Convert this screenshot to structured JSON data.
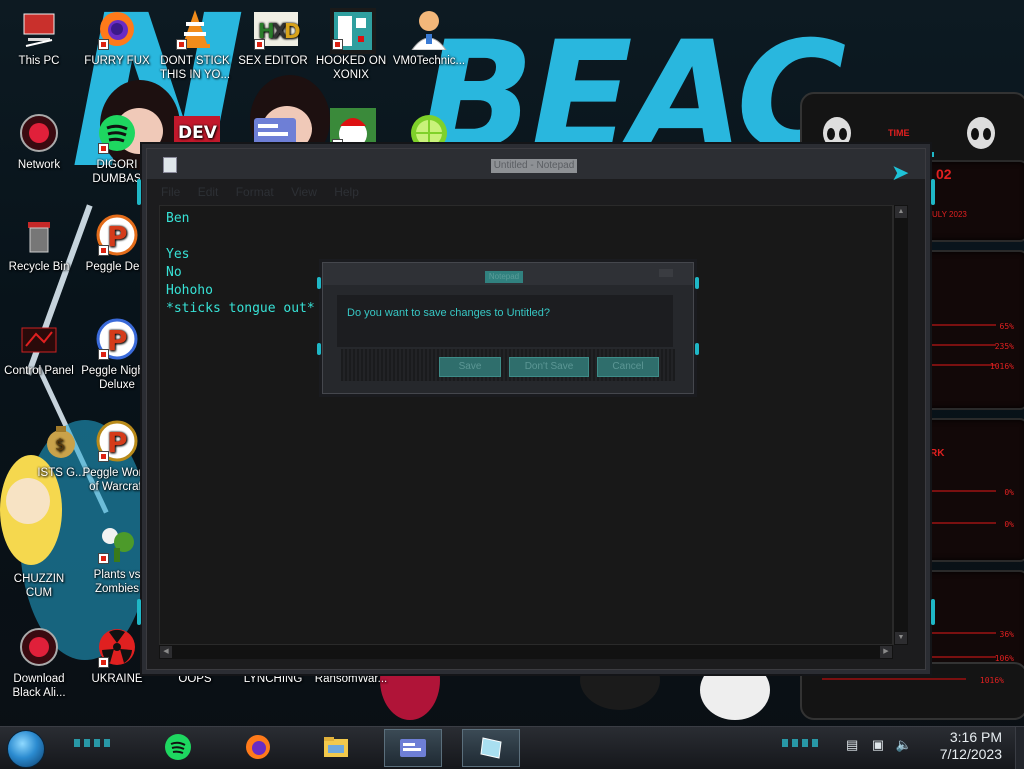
{
  "desktop": {
    "icons": [
      {
        "id": "this-pc",
        "label": "This PC"
      },
      {
        "id": "furry-fux",
        "label": "FURRY FUX"
      },
      {
        "id": "dont-stick",
        "label": "DONT STICK THIS IN YO..."
      },
      {
        "id": "sex-editor",
        "label": "SEX EDITOR"
      },
      {
        "id": "hooked-on-xonix",
        "label": "HOOKED ON XONIX"
      },
      {
        "id": "vm0technic",
        "label": "VM0Technic..."
      },
      {
        "id": "network",
        "label": "Network"
      },
      {
        "id": "digori-dumbas",
        "label": "DIGORI DUMBAS"
      },
      {
        "id": "recycle-bin",
        "label": "Recycle Bin"
      },
      {
        "id": "peggle-deluxe",
        "label": "Peggle Delu"
      },
      {
        "id": "control-panel",
        "label": "Control Panel"
      },
      {
        "id": "peggle-nights",
        "label": "Peggle Nights Deluxe"
      },
      {
        "id": "ists",
        "label": "ISTS G..."
      },
      {
        "id": "peggle-world-of-warcraft",
        "label": "Peggle World of Warcraft"
      },
      {
        "id": "chuzzin-cum",
        "label": "CHUZZIN CUM"
      },
      {
        "id": "plants-vs-zombies",
        "label": "Plants vs Zombies"
      },
      {
        "id": "download-black",
        "label": "Download Black Ali..."
      },
      {
        "id": "ukraine",
        "label": "UKRAINE"
      },
      {
        "id": "oops",
        "label": "OOPS"
      },
      {
        "id": "lynching",
        "label": "LYNCHING"
      },
      {
        "id": "ransomware",
        "label": "RansomWar..."
      }
    ],
    "dev_label": "DEV"
  },
  "notepad": {
    "title": "Untitled - Notepad",
    "menu": [
      "File",
      "Edit",
      "Format",
      "View",
      "Help"
    ],
    "lines": [
      "Ben",
      "",
      "Yes",
      "No",
      "Hohoho",
      "*sticks tongue out*"
    ]
  },
  "dialog": {
    "title": "Notepad",
    "message": "Do you want to save changes to Untitled?",
    "buttons": {
      "save": "Save",
      "dont_save": "Don't Save",
      "cancel": "Cancel"
    }
  },
  "gadget": {
    "time_label": "TIME",
    "date_fragment": "02",
    "month_fragment": "JULY 2023",
    "readouts": [
      "65%",
      "235%",
      "1016%",
      "0%",
      "0%",
      "36%",
      "106%",
      "1016%"
    ],
    "tag": "RK"
  },
  "taskbar": {
    "time": "3:16 PM",
    "date": "7/12/2023"
  },
  "colors": {
    "accent_cyan": "#1fb7c6",
    "notepad_text": "#37e2d6",
    "gadget_red": "#e02020"
  }
}
